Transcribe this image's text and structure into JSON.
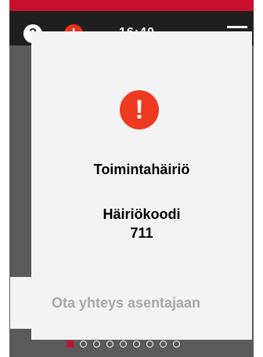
{
  "status_bar": {
    "help_icon": "question-mark-icon",
    "alert_icon": "exclamation-icon",
    "time": "16:40",
    "menu_icon": "hamburger-menu-icon"
  },
  "dialog": {
    "icon": "alert-exclamation-icon",
    "icon_color": "#ee3a20",
    "title": "Toimintahäiriö",
    "fault_code_label": "Häiriökoodi",
    "fault_code_value": "711",
    "contact_button_label": "Ota yhteys asentajaan"
  },
  "pager": {
    "total_pages": 9,
    "active_page": 1,
    "active_color": "#c8102e"
  },
  "colors": {
    "accent": "#c8102e",
    "status_bar": "#1f1f1f",
    "background": "#5a5a5a",
    "dialog": "#f3f3f3"
  }
}
